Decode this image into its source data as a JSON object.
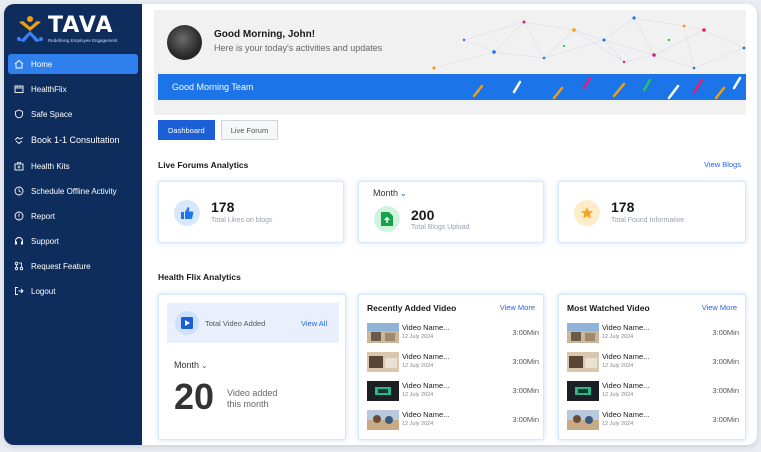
{
  "brand": {
    "name": "TAVA",
    "tagline": "Redefining Employee Engagement"
  },
  "sidebar": {
    "items": [
      {
        "label": "Home",
        "icon": "home-icon",
        "active": true
      },
      {
        "label": "HealthFlix",
        "icon": "film-icon"
      },
      {
        "label": "Safe Space",
        "icon": "shield-icon"
      },
      {
        "label": "Book 1-1 Consultation",
        "icon": "handshake-icon"
      },
      {
        "label": "Health Kits",
        "icon": "kit-icon"
      },
      {
        "label": "Schedule Offline Activity",
        "icon": "clock-icon"
      },
      {
        "label": "Report",
        "icon": "alert-icon"
      },
      {
        "label": "Support",
        "icon": "headset-icon"
      },
      {
        "label": "Request Feature",
        "icon": "feature-icon"
      },
      {
        "label": "Logout",
        "icon": "logout-icon"
      }
    ]
  },
  "hero": {
    "greeting": "Good Morning, John!",
    "subtitle": "Here is your today's activities and updates",
    "banner": "Good Morning Team"
  },
  "tabs": [
    {
      "label": "Dashboard",
      "active": true
    },
    {
      "label": "Live Forum",
      "active": false
    }
  ],
  "live_forums": {
    "title": "Live Forums Analytics",
    "link": "View Blogs",
    "likes": {
      "value": "178",
      "label": "Total Likes on blogs"
    },
    "blogs": {
      "month": "Month",
      "value": "200",
      "label": "Total Blogs Upload"
    },
    "informative": {
      "value": "178",
      "label": "Total Found Informative"
    }
  },
  "health_flix": {
    "title": "Health Flix Analytics",
    "total": {
      "label": "Total Video Added",
      "link": "View All",
      "month": "Month",
      "count": "20",
      "count_label_1": "Video added",
      "count_label_2": "this month"
    },
    "recent": {
      "title": "Recently Added Video",
      "link": "View More",
      "videos": [
        {
          "name": "Video Name...",
          "date": "12 July 2024",
          "duration": "3:00Min"
        },
        {
          "name": "Video Name...",
          "date": "12 July 2024",
          "duration": "3:00Min"
        },
        {
          "name": "Video Name...",
          "date": "12 July 2024",
          "duration": "3:00Min"
        },
        {
          "name": "Video Name...",
          "date": "12 July 2024",
          "duration": "3:00Min"
        }
      ]
    },
    "most_watched": {
      "title": "Most Watched Video",
      "link": "View More",
      "videos": [
        {
          "name": "Video Name...",
          "date": "12 July 2024",
          "duration": "3:00Min"
        },
        {
          "name": "Video Name...",
          "date": "12 July 2024",
          "duration": "3:00Min"
        },
        {
          "name": "Video Name...",
          "date": "12 July 2024",
          "duration": "3:00Min"
        },
        {
          "name": "Video Name...",
          "date": "12 July 2024",
          "duration": "3:00Min"
        }
      ]
    }
  },
  "colors": {
    "sidebar": "#0e2d5c",
    "accent": "#1b74e8",
    "active_nav": "#2f80ed"
  }
}
